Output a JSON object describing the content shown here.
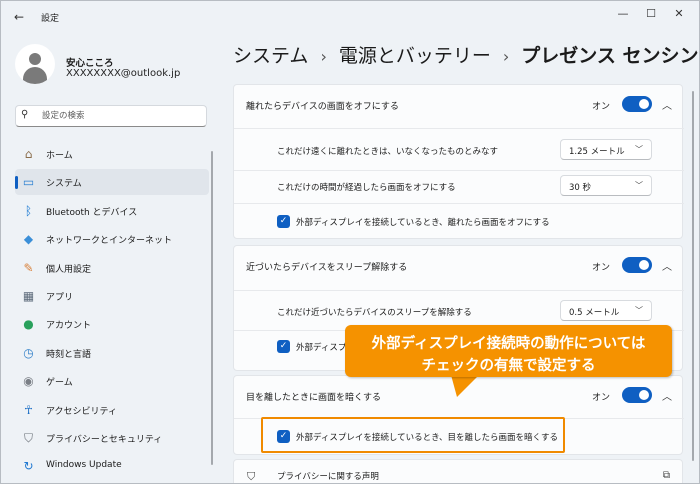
{
  "window": {
    "title": "設定",
    "back_icon": "back-arrow-icon",
    "controls": {
      "minimize": "—",
      "maximize": "☐",
      "close": "✕"
    }
  },
  "profile": {
    "name": "安心こころ",
    "email": "XXXXXXXX@outlook.jp"
  },
  "search": {
    "placeholder": "設定の検索"
  },
  "nav": [
    {
      "label": "ホーム",
      "icon": "home-icon",
      "color": "#8a6d4b",
      "active": false
    },
    {
      "label": "システム",
      "icon": "system-icon",
      "color": "#2a7fd1",
      "active": true
    },
    {
      "label": "Bluetooth とデバイス",
      "icon": "bluetooth-icon",
      "color": "#1576d2",
      "active": false
    },
    {
      "label": "ネットワークとインターネット",
      "icon": "network-icon",
      "color": "#3b8fd8",
      "active": false
    },
    {
      "label": "個人用設定",
      "icon": "brush-icon",
      "color": "#d8803a",
      "active": false
    },
    {
      "label": "アプリ",
      "icon": "apps-icon",
      "color": "#5c6a7a",
      "active": false
    },
    {
      "label": "アカウント",
      "icon": "account-icon",
      "color": "#29a05c",
      "active": false
    },
    {
      "label": "時刻と言語",
      "icon": "clock-globe-icon",
      "color": "#2f7fc8",
      "active": false
    },
    {
      "label": "ゲーム",
      "icon": "gamepad-icon",
      "color": "#7a7f86",
      "active": false
    },
    {
      "label": "アクセシビリティ",
      "icon": "accessibility-icon",
      "color": "#1d6fc5",
      "active": false
    },
    {
      "label": "プライバシーとセキュリティ",
      "icon": "shield-icon",
      "color": "#6b7178",
      "active": false
    },
    {
      "label": "Windows Update",
      "icon": "update-icon",
      "color": "#1f78d1",
      "active": false
    }
  ],
  "breadcrumb": {
    "level1": "システム",
    "level2": "電源とバッテリー",
    "current": "プレゼンス センシング",
    "separator": "›"
  },
  "sections": {
    "away": {
      "title": "離れたらデバイスの画面をオフにする",
      "toggle_label": "オン",
      "rows": [
        {
          "label": "これだけ遠くに離れたときは、いなくなったものとみなす",
          "value": "1.25 メートル"
        },
        {
          "label": "これだけの時間が経過したら画面をオフにする",
          "value": "30 秒"
        }
      ],
      "checkbox_label": "外部ディスプレイを接続しているとき、離れたら画面をオフにする"
    },
    "approach": {
      "title": "近づいたらデバイスをスリープ解除する",
      "toggle_label": "オン",
      "row": {
        "label": "これだけ近づいたらデバイスのスリープを解除する",
        "value": "0.5 メートル"
      },
      "checkbox_label": "外部ディスプレ"
    },
    "dim": {
      "title": "目を離したときに画面を暗くする",
      "toggle_label": "オン",
      "checkbox_label": "外部ディスプレイを接続しているとき、目を離したら画面を暗くする"
    },
    "privacy": {
      "label": "プライバシーに関する声明"
    }
  },
  "callout": {
    "line1": "外部ディスプレイ接続時の動作については",
    "line2": "チェックの有無で設定する",
    "color": "#f59200"
  },
  "accent_color": "#0f5fc2"
}
